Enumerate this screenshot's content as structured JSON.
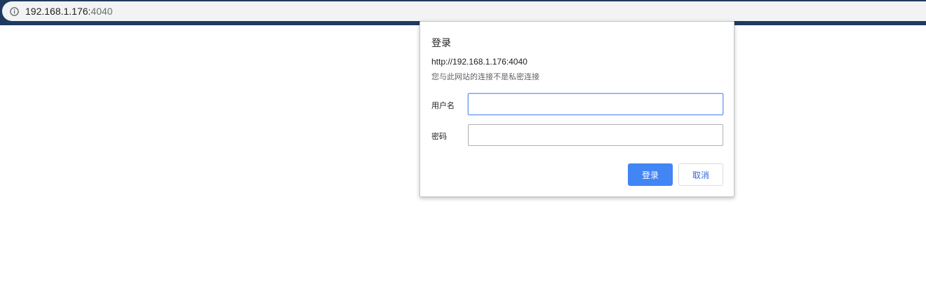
{
  "browser": {
    "url_host": "192.168.1.176:",
    "url_port": "4040",
    "icon": "info-icon"
  },
  "dialog": {
    "title": "登录",
    "origin": "http://192.168.1.176:4040",
    "warning": "您与此网站的连接不是私密连接",
    "username_label": "用户名",
    "username_value": "",
    "password_label": "密码",
    "password_value": "",
    "login_button": "登录",
    "cancel_button": "取消"
  },
  "colors": {
    "primary": "#4285f4",
    "frame": "#1f3a5f"
  }
}
